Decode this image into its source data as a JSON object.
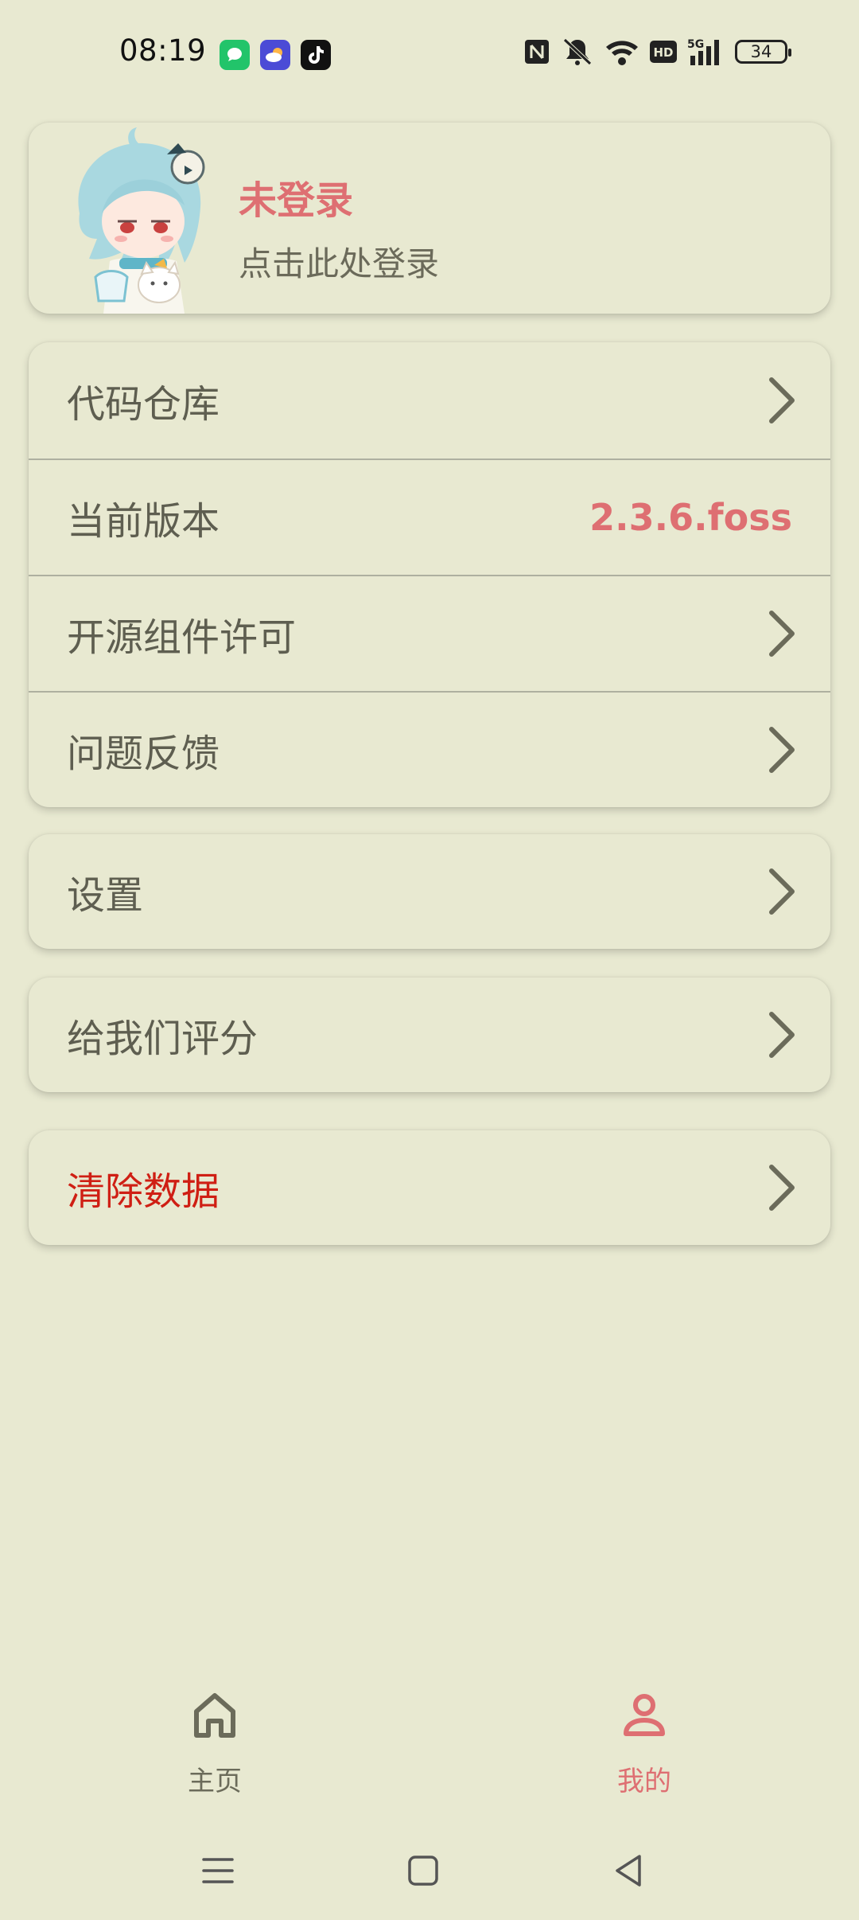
{
  "status": {
    "time": "08:19",
    "battery": "34",
    "icons": [
      "messages-app-icon",
      "weather-app-icon",
      "tiktok-app-icon",
      "nfc-icon",
      "mute-icon",
      "wifi-icon",
      "hd-icon",
      "signal-5g-icon"
    ]
  },
  "profile": {
    "name": "未登录",
    "hint": "点击此处登录"
  },
  "menu_group1": [
    {
      "label": "代码仓库"
    },
    {
      "label": "当前版本",
      "value": "2.3.6.foss"
    },
    {
      "label": "开源组件许可"
    },
    {
      "label": "问题反馈"
    }
  ],
  "settings": {
    "label": "设置"
  },
  "rate": {
    "label": "给我们评分"
  },
  "clear": {
    "label": "清除数据"
  },
  "nav": {
    "home": "主页",
    "mine": "我的"
  },
  "colors": {
    "background": "#e8e9d1",
    "accent": "#de6f72",
    "danger": "#cf1f14",
    "text": "#5e5e50"
  }
}
